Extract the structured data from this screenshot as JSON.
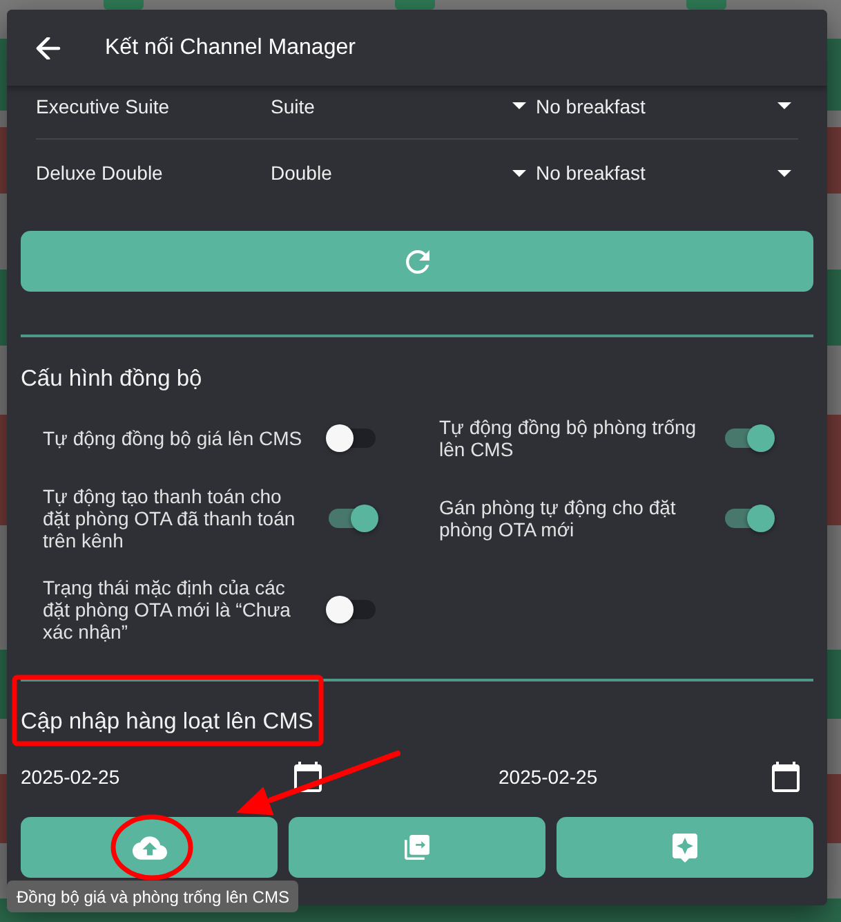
{
  "dialog": {
    "title": "Kết nối Channel Manager"
  },
  "room_mappings": [
    {
      "room": "Executive Suite",
      "room_type": "Suite",
      "meal_plan": "No breakfast"
    },
    {
      "room": "Deluxe Double",
      "room_type": "Double",
      "meal_plan": "No breakfast"
    }
  ],
  "sync_settings": {
    "heading": "Cấu hình đồng bộ",
    "toggles": [
      {
        "label": "Tự động đồng bộ giá lên CMS",
        "on": false
      },
      {
        "label": "Tự động đồng bộ phòng trống lên CMS",
        "on": true
      },
      {
        "label": "Tự động tạo thanh toán cho đặt phòng OTA đã thanh toán trên kênh",
        "on": true
      },
      {
        "label": "Gán phòng tự động cho đặt phòng OTA mới",
        "on": true
      },
      {
        "label": "Trạng thái mặc định của các đặt phòng OTA mới là “Chưa xác nhận”",
        "on": false
      }
    ]
  },
  "bulk_update": {
    "heading": "Cập nhập hàng loạt lên CMS",
    "dates": [
      "2025-02-25",
      "2025-02-25"
    ],
    "actions": [
      {
        "kind": "upload"
      },
      {
        "kind": "copy"
      },
      {
        "kind": "assistant"
      }
    ]
  },
  "tooltip": {
    "text": "Đồng bộ giá và phòng trống lên CMS"
  },
  "annotations": [
    {
      "kind": "box"
    },
    {
      "kind": "arrow"
    },
    {
      "kind": "ellipse"
    }
  ]
}
